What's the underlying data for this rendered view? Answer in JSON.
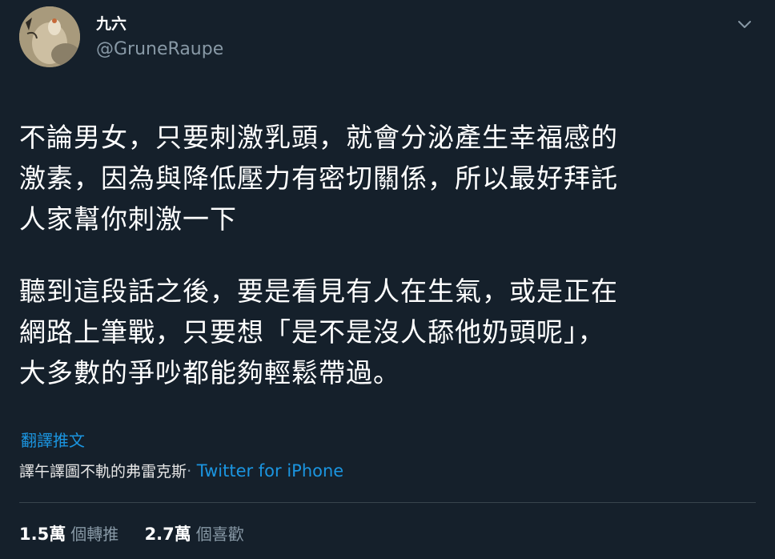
{
  "user": {
    "display_name": "九六",
    "handle": "@GruneRaupe"
  },
  "tweet": {
    "paragraph1": [
      "不論男女，只要刺激乳頭，就會分泌產生幸福感的",
      "激素，因為與降低壓力有密切關係，所以最好拜託",
      "人家幫你刺激一下"
    ],
    "paragraph2": [
      "聽到這段話之後，要是看見有人在生氣，或是正在",
      "網路上筆戰，只要想「是不是沒人舔他奶頭呢」，",
      "大多數的爭吵都能夠輕鬆帶過。"
    ]
  },
  "translate_link": "翻譯推文",
  "meta": {
    "overlay_text": "譯午譯圖不軌的弗雷克斯",
    "separator": "·",
    "source": "Twitter for iPhone"
  },
  "stats": {
    "retweets_count": "1.5萬",
    "retweets_label": "個轉推",
    "likes_count": "2.7萬",
    "likes_label": "個喜歡"
  },
  "colors": {
    "background": "#15202b",
    "secondary_text": "#8899a6",
    "link": "#1b95e0",
    "divider": "#38444d"
  },
  "icons": {
    "caret": "chevron-down-icon",
    "avatar": "profile-avatar-image"
  }
}
